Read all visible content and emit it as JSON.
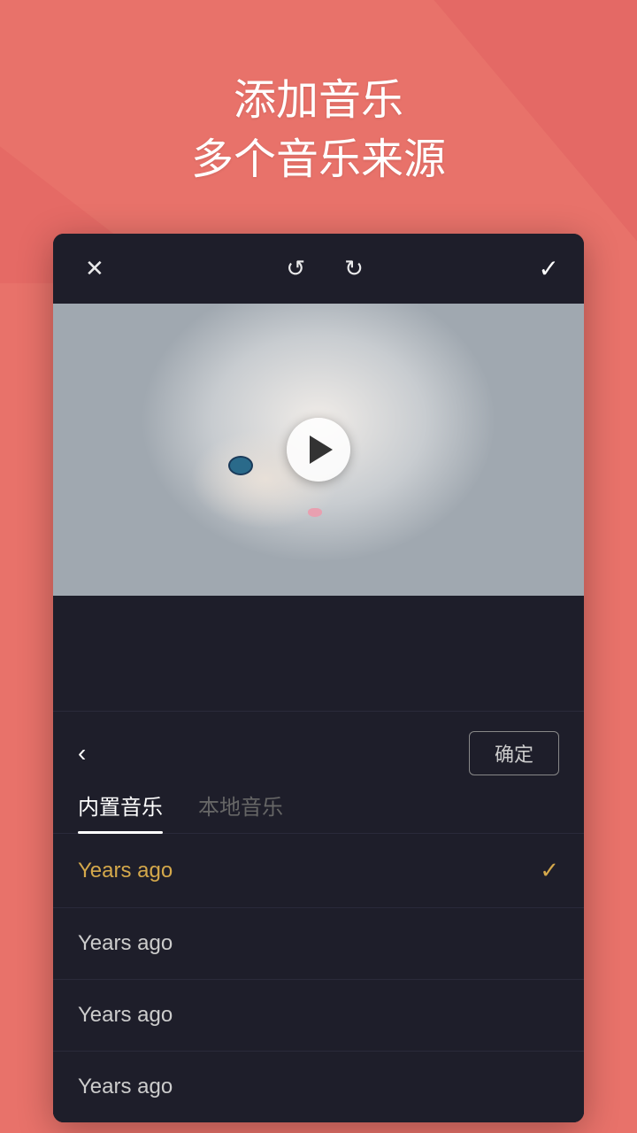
{
  "background_color": "#e8726a",
  "header": {
    "line1": "添加音乐",
    "line2": "多个音乐来源"
  },
  "toolbar": {
    "close_icon": "✕",
    "undo_icon": "↺",
    "redo_icon": "↻",
    "confirm_icon": "✓"
  },
  "music_panel": {
    "back_icon": "‹",
    "confirm_button": "确定",
    "tabs": [
      {
        "label": "内置音乐",
        "active": true
      },
      {
        "label": "本地音乐",
        "active": false
      }
    ],
    "music_items": [
      {
        "name": "Years ago",
        "selected": true
      },
      {
        "name": "Years ago",
        "selected": false
      },
      {
        "name": "Years ago",
        "selected": false
      },
      {
        "name": "Years ago",
        "selected": false
      }
    ]
  }
}
